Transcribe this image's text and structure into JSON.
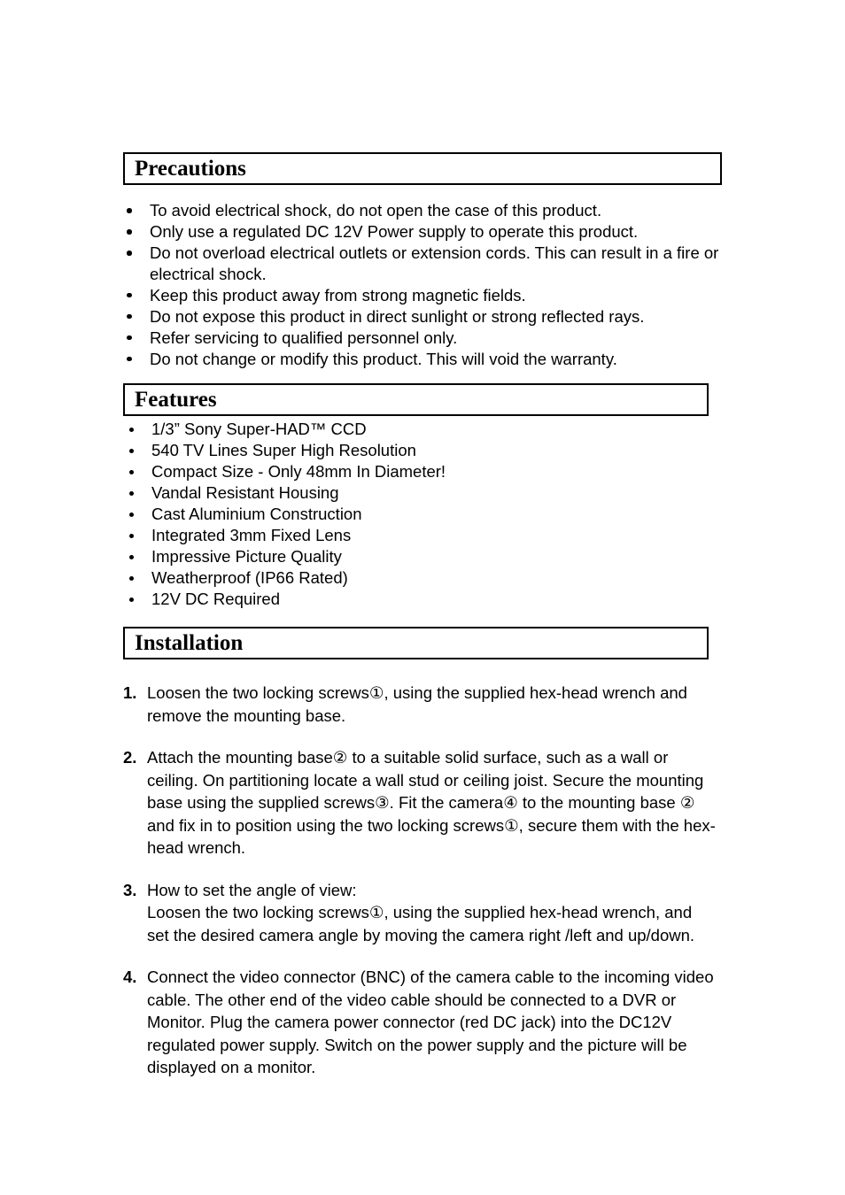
{
  "document": {
    "sections": [
      {
        "id": "precautions",
        "heading": "Precautions",
        "items": [
          "To avoid electrical shock, do not open the case of this product.",
          "Only use a regulated DC 12V Power supply to operate this product.",
          "Do not overload electrical outlets or extension cords. This can result in a fire or electrical shock.",
          "Keep this product away from strong magnetic fields.",
          "Do not expose this product in direct sunlight or strong reflected rays.",
          "Refer servicing to qualified personnel only.",
          "Do not change or modify this product. This will void the warranty."
        ]
      },
      {
        "id": "features",
        "heading": "Features",
        "items": [
          "1/3” Sony Super-HAD™ CCD",
          "540 TV Lines Super High Resolution",
          "Compact Size - Only 48mm In Diameter!",
          "Vandal Resistant Housing",
          "Cast Aluminium Construction",
          "Integrated 3mm Fixed Lens",
          "Impressive Picture Quality",
          "Weatherproof (IP66 Rated)",
          "12V DC Required"
        ]
      },
      {
        "id": "installation",
        "heading": "Installation",
        "steps": [
          {
            "number": "1.",
            "lines": [
              "Loosen the two locking screws①, using the supplied hex-head wrench and remove the mounting base."
            ]
          },
          {
            "number": "2.",
            "lines": [
              "Attach the mounting base② to a suitable solid surface, such as a wall or ceiling. On partitioning locate a wall stud or ceiling joist. Secure the mounting base using the supplied screws③. Fit the camera④ to the mounting base ② and fix in to position using the two locking screws①, secure them with the hex-head wrench."
            ]
          },
          {
            "number": "3.",
            "lines": [
              "How to set the angle of view:",
              "Loosen the two locking screws①, using the supplied hex-head wrench, and set the desired camera angle by moving the camera right /left and up/down."
            ]
          },
          {
            "number": "4.",
            "lines": [
              "Connect the video connector (BNC) of the camera cable to the incoming video cable.  The other end of the video cable should be connected to a DVR or Monitor. Plug the camera power connector (red DC jack) into the DC12V regulated power supply. Switch on the power supply and the picture will be displayed on a monitor."
            ]
          }
        ]
      }
    ]
  },
  "colors": {
    "text": "#000000",
    "background": "#ffffff",
    "border": "#000000"
  }
}
